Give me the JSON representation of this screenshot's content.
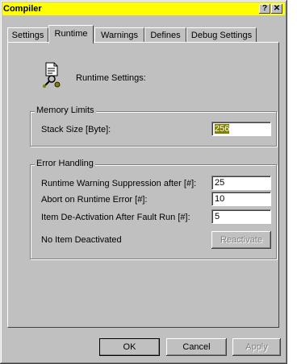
{
  "window": {
    "title": "Compiler",
    "help_glyph": "?",
    "close_glyph": "✕"
  },
  "tabs": [
    {
      "label": "Settings"
    },
    {
      "label": "Runtime"
    },
    {
      "label": "Warnings"
    },
    {
      "label": "Defines"
    },
    {
      "label": "Debug Settings"
    }
  ],
  "runtime": {
    "heading": "Runtime Settings:",
    "icon": "runtime-settings-icon"
  },
  "memory": {
    "title": "Memory Limits",
    "stack_label": "Stack Size [Byte]:",
    "stack_value": "256"
  },
  "errors": {
    "title": "Error Handling",
    "suppression_label": "Runtime Warning Suppression after [#]:",
    "suppression_value": "25",
    "abort_label": "Abort on Runtime Error [#]:",
    "abort_value": "10",
    "deactivation_label": "Item De-Activation After Fault Run [#]:",
    "deactivation_value": "5",
    "status_text": "No Item Deactivated",
    "reactivate_label": "Reactivate"
  },
  "buttons": {
    "ok": "OK",
    "cancel": "Cancel",
    "apply": "Apply"
  },
  "colors": {
    "titlebar": "#ffff00",
    "face": "#c0c0c0",
    "selection": "#808000"
  }
}
